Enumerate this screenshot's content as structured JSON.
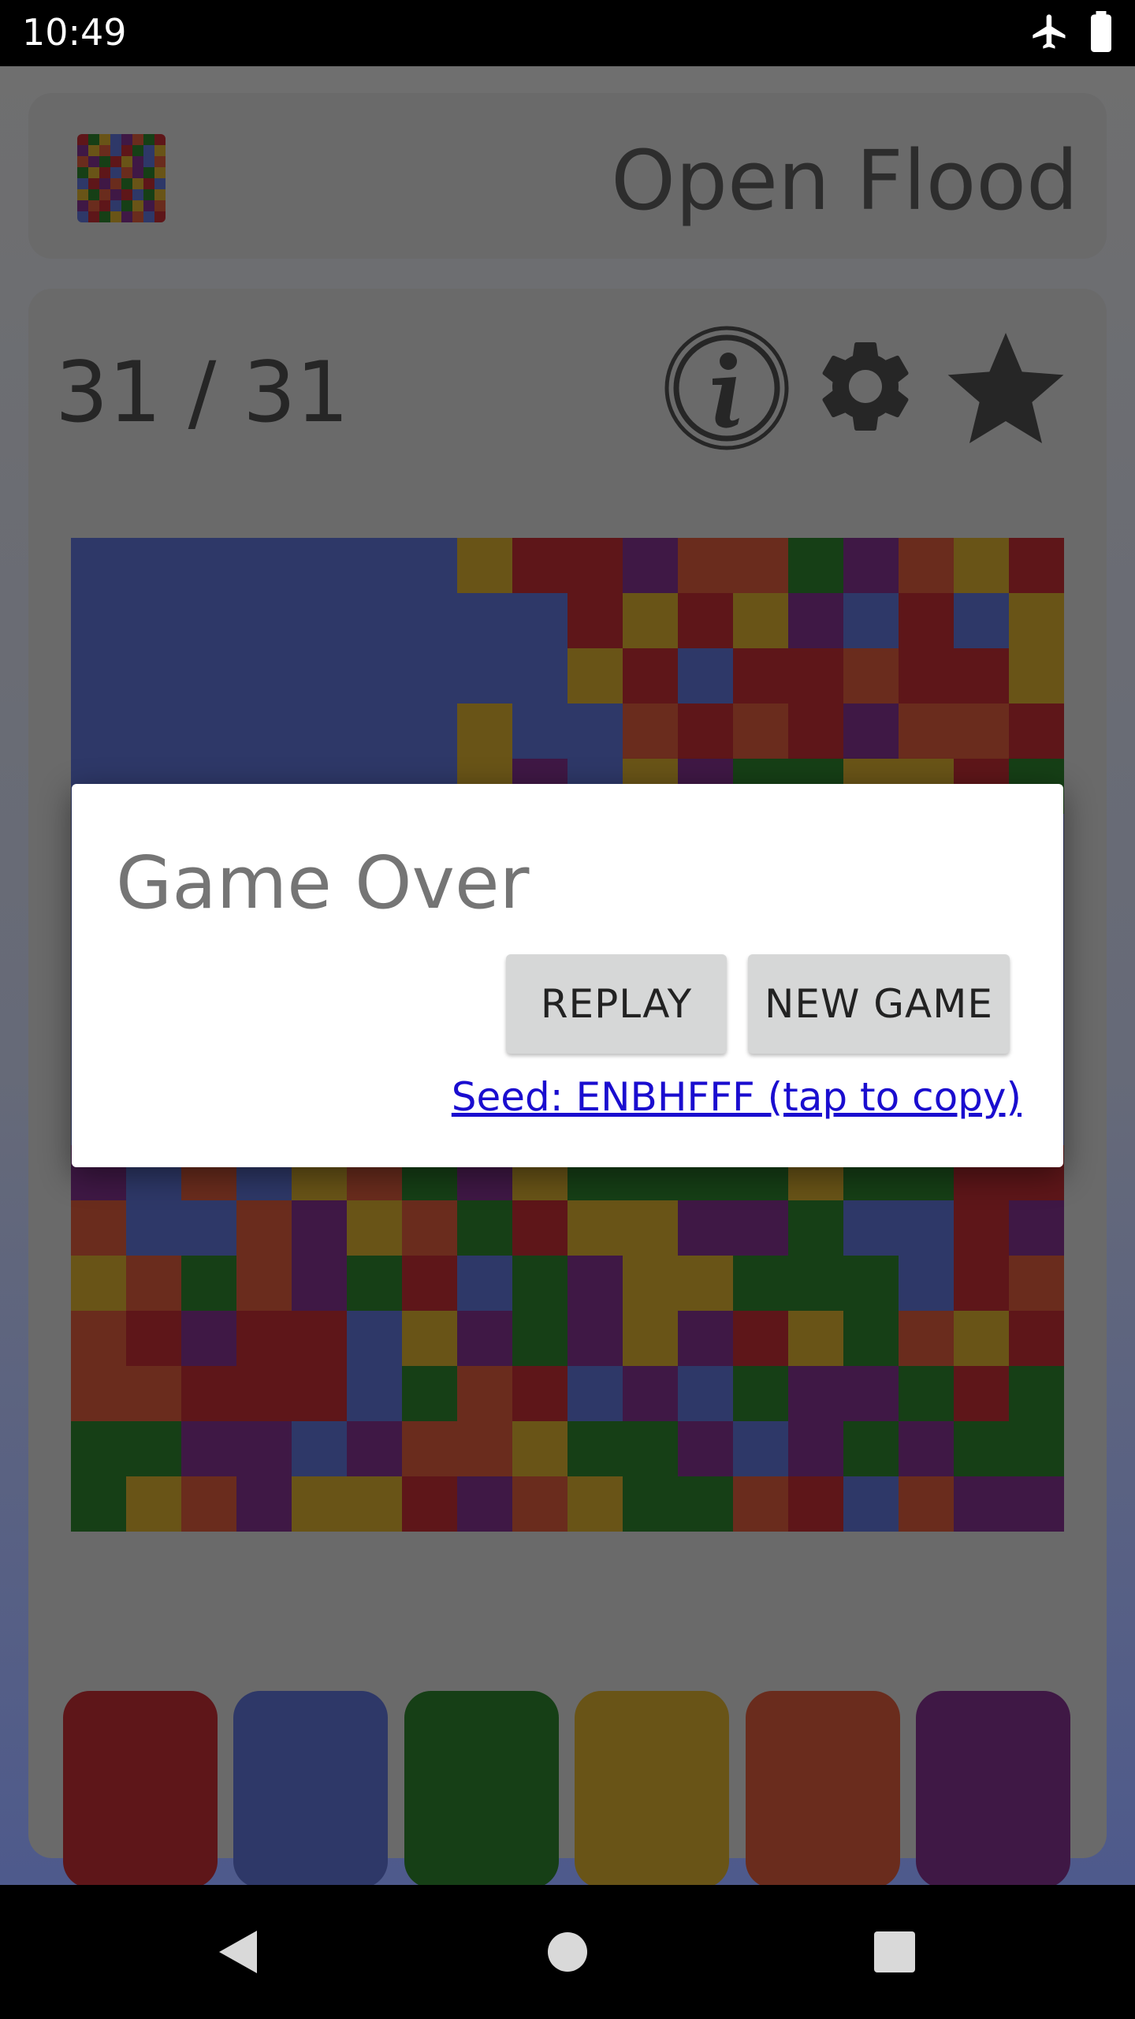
{
  "status_bar": {
    "time": "10:49",
    "icons": [
      "airplane-icon",
      "battery-icon"
    ]
  },
  "header": {
    "app_title": "Open Flood",
    "logo_icon": "flood-grid-logo"
  },
  "toolbar": {
    "move_counter": "31 / 31",
    "icons": [
      "info-icon",
      "settings-gear-icon",
      "star-icon"
    ]
  },
  "palette": {
    "R": "#5e1619",
    "B": "#2e3868",
    "G": "#163f16",
    "Y": "#695417",
    "O": "#6a2c1d",
    "P": "#3f1845"
  },
  "board": {
    "size": 18,
    "rows": [
      "BBBBBBBYRRPOOGPOYR",
      "BBBBBBBBBRYRYPBRBY",
      "BBBBBBBBBYRBRRORRY",
      "BBBBBBBYBBORORPOOR",
      "BBBBBBBYPBYPGGYYRG",
      "BBBBBBBBBBBBBBBBBB",
      "BBBBBBBBBBBBBBBBBB",
      "BBBBBBBBBBBBBBBBBB",
      "BBBBBBBBBBBBBBBBBB",
      "BBBBBBBBBBBBBBBBBB",
      "BBBBBBBBBBBBBBBBBB",
      "PBOBYOGPYGGGGYGGRR",
      "OBBOPYOGRYYPPGBBRP",
      "YOGOPGRBGPYYGGGBRO",
      "ORPRRBYPGPYPRYGOYR",
      "OORRRBGORBPBGPPGRG",
      "GGPPBPOOYGGPBPGPGG",
      "GYOPYYRPOYGGORBOPP"
    ]
  },
  "color_buttons": [
    {
      "name": "red",
      "color": "#5e1619"
    },
    {
      "name": "blue",
      "color": "#2e3868"
    },
    {
      "name": "green",
      "color": "#163f16"
    },
    {
      "name": "yellow",
      "color": "#695417"
    },
    {
      "name": "orange",
      "color": "#6a2c1d"
    },
    {
      "name": "purple",
      "color": "#3f1845"
    }
  ],
  "dialog": {
    "title": "Game Over",
    "replay_label": "REPLAY",
    "new_game_label": "NEW GAME",
    "seed_link": "Seed: ENBHFFF (tap to copy)"
  },
  "nav_bar": {
    "icons": [
      "back-icon",
      "home-icon",
      "recents-icon"
    ]
  }
}
